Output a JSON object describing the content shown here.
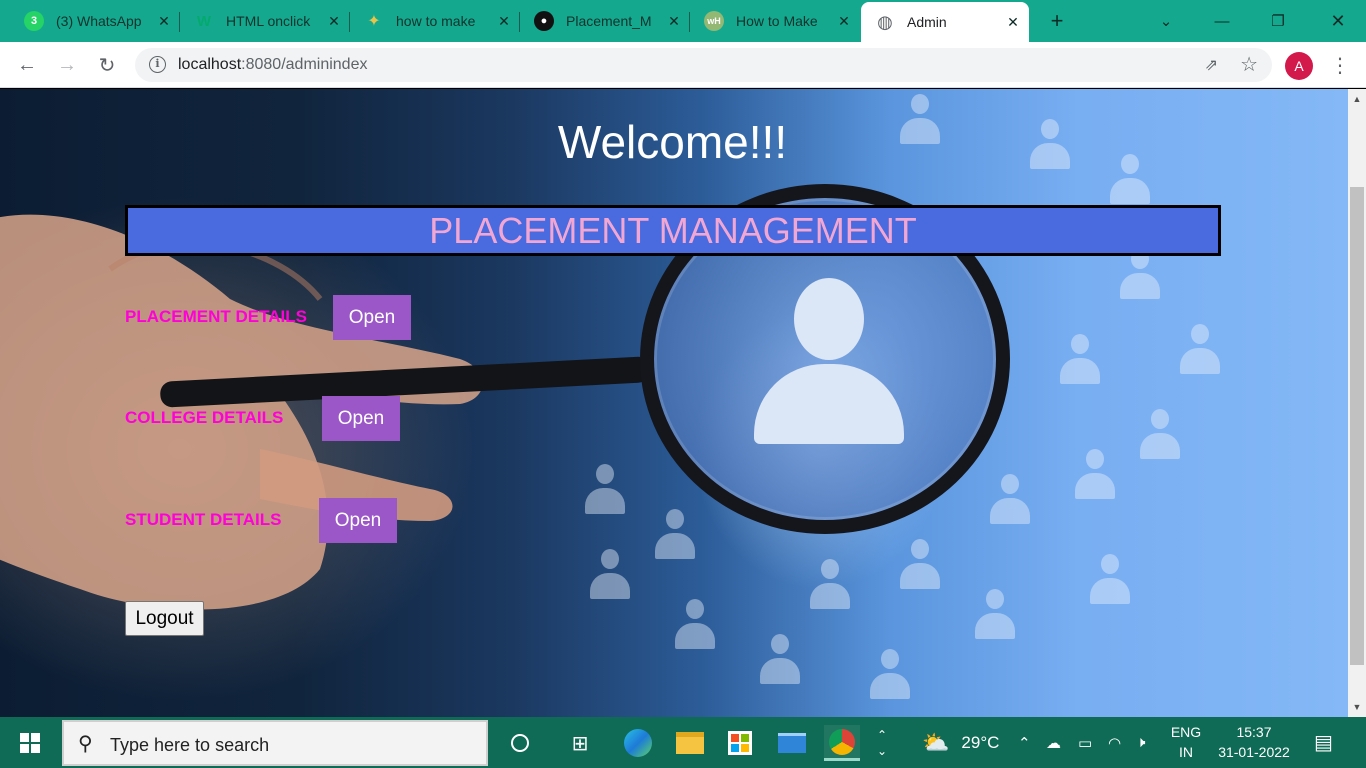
{
  "browser": {
    "tabs": [
      {
        "title": "(3) WhatsApp",
        "icon": "whatsapp-icon"
      },
      {
        "title": "HTML onclick",
        "icon": "w3schools-icon"
      },
      {
        "title": "how to make",
        "icon": "search-result-icon"
      },
      {
        "title": "Placement_M",
        "icon": "github-icon"
      },
      {
        "title": "How to Make",
        "icon": "wikihow-icon"
      },
      {
        "title": "Admin",
        "icon": "globe-icon"
      }
    ],
    "url_host": "localhost",
    "url_rest": ":8080/adminindex",
    "avatar_letter": "A"
  },
  "page": {
    "welcome": "Welcome!!!",
    "banner": "PLACEMENT MANAGEMENT",
    "rows": [
      {
        "label": "PLACEMENT DETAILS",
        "button": "Open"
      },
      {
        "label": "COLLEGE DETAILS",
        "button": "Open"
      },
      {
        "label": "STUDENT DETAILS",
        "button": "Open"
      }
    ],
    "logout": "Logout",
    "colors": {
      "label": "#ff00d8",
      "button": "#9b57c7",
      "banner_bg": "#4a6ae0",
      "banner_text": "#f2a7d3"
    }
  },
  "taskbar": {
    "search_placeholder": "Type here to search",
    "weather": "29°C",
    "lang_line1": "ENG",
    "lang_line2": "IN",
    "time": "15:37",
    "date": "31-01-2022"
  }
}
